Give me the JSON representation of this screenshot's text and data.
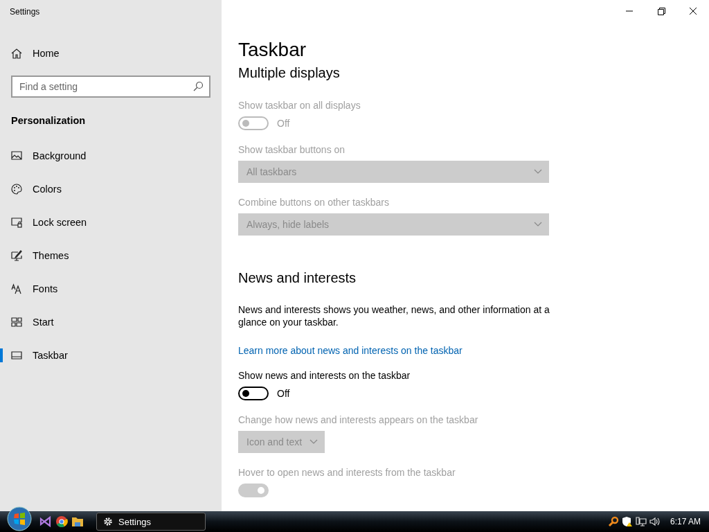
{
  "window": {
    "title": "Settings"
  },
  "sidebar": {
    "home": "Home",
    "search": {
      "placeholder": "Find a setting"
    },
    "section": "Personalization",
    "items": [
      {
        "label": "Background",
        "selected": false
      },
      {
        "label": "Colors",
        "selected": false
      },
      {
        "label": "Lock screen",
        "selected": false
      },
      {
        "label": "Themes",
        "selected": false
      },
      {
        "label": "Fonts",
        "selected": false
      },
      {
        "label": "Start",
        "selected": false
      },
      {
        "label": "Taskbar",
        "selected": true
      }
    ]
  },
  "page": {
    "title": "Taskbar",
    "sections": [
      {
        "heading": "Multiple displays",
        "settings": [
          {
            "kind": "toggle",
            "label": "Show taskbar on all displays",
            "disabled": true,
            "on": false,
            "state_label": "Off"
          },
          {
            "kind": "dropdown",
            "label": "Show taskbar buttons on",
            "value": "All taskbars",
            "disabled": true,
            "wide": true
          },
          {
            "kind": "dropdown",
            "label": "Combine buttons on other taskbars",
            "value": "Always, hide labels",
            "disabled": true,
            "wide": true
          }
        ]
      },
      {
        "heading": "News and interests",
        "settings": [
          {
            "kind": "text",
            "label": "News and interests shows you weather, news, and other information at a glance on your taskbar."
          },
          {
            "kind": "link",
            "label": "Learn more about news and interests on the taskbar"
          },
          {
            "kind": "toggle",
            "label": "Show news and interests on the taskbar",
            "disabled": false,
            "on": false,
            "state_label": "Off"
          },
          {
            "kind": "dropdown",
            "label": "Change how news and interests appears on the taskbar",
            "value": "Icon and text",
            "disabled": true,
            "wide": false
          },
          {
            "kind": "toggle",
            "label": "Hover to open news and interests from the taskbar",
            "disabled": true,
            "on": true
          }
        ]
      }
    ]
  },
  "taskbar": {
    "task": "Settings",
    "clock": "6:17 AM"
  }
}
